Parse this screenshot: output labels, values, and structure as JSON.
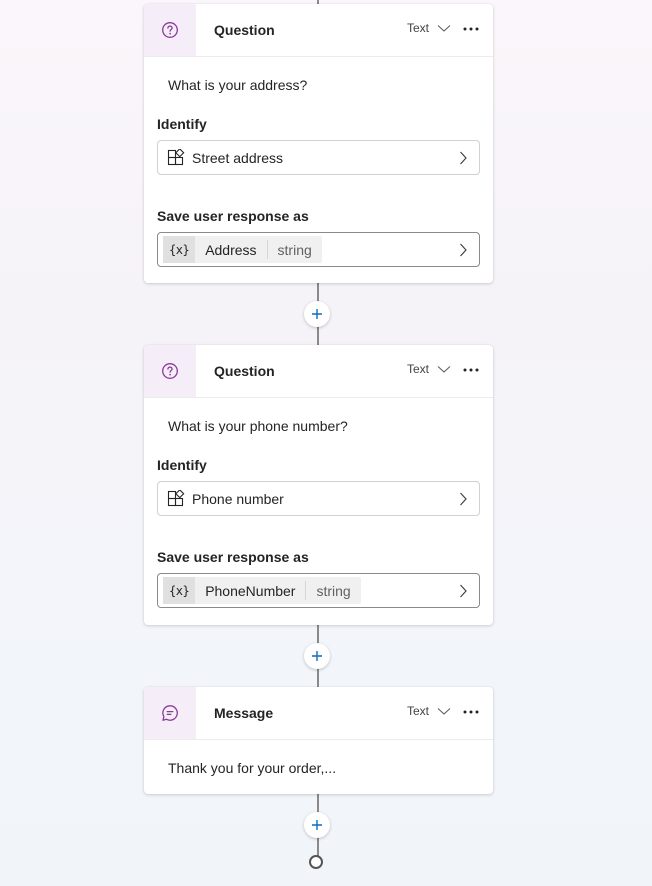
{
  "nodes": [
    {
      "kind": "Question",
      "title": "Question",
      "type_label": "Text",
      "prompt": "What is your address?",
      "identify_label": "Identify",
      "identify_value": "Street address",
      "save_label": "Save user response as",
      "variable_token": "{x}",
      "variable_name": "Address",
      "variable_type": "string"
    },
    {
      "kind": "Question",
      "title": "Question",
      "type_label": "Text",
      "prompt": "What is your phone number?",
      "identify_label": "Identify",
      "identify_value": "Phone number",
      "save_label": "Save user response as",
      "variable_token": "{x}",
      "variable_name": "PhoneNumber",
      "variable_type": "string"
    },
    {
      "kind": "Message",
      "title": "Message",
      "type_label": "Text",
      "prompt": "Thank you for your order,..."
    }
  ],
  "icons": {
    "question": "question-circle-icon",
    "message": "chat-bubble-icon",
    "identify": "entity-icon",
    "more": "more-horizontal-icon",
    "add": "plus-icon"
  },
  "colors": {
    "accent_purple": "#8b3a9a",
    "accent_blue": "#0f6cbd",
    "icon_tile_bg": "#f5eef8"
  }
}
